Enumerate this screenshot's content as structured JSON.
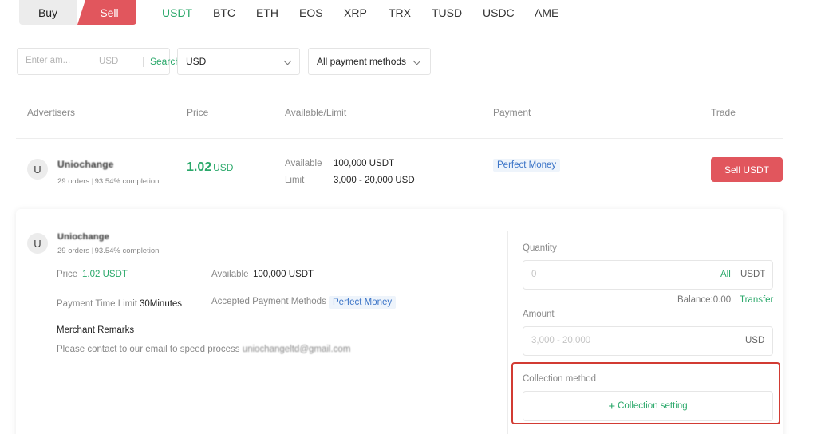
{
  "trade_tabs": {
    "buy": "Buy",
    "sell": "Sell"
  },
  "coins": [
    "USDT",
    "BTC",
    "ETH",
    "EOS",
    "XRP",
    "TRX",
    "TUSD",
    "USDC",
    "AME"
  ],
  "filters": {
    "amount_placeholder": "Enter am...",
    "amount_unit": "USD",
    "search_label": "Search",
    "currency": "USD",
    "payment_method": "All payment methods"
  },
  "table": {
    "headers": {
      "advertisers": "Advertisers",
      "price": "Price",
      "available_limit": "Available/Limit",
      "payment": "Payment",
      "trade": "Trade"
    }
  },
  "listing": {
    "avatar_letter": "U",
    "merchant": "Uniochange",
    "orders": "29 orders",
    "completion": "93.54% completion",
    "price": "1.02",
    "price_currency": "USD",
    "available_label": "Available",
    "available_value": "100,000 USDT",
    "limit_label": "Limit",
    "limit_value": "3,000 - 20,000 USD",
    "payment_method": "Perfect Money",
    "action_label": "Sell USDT"
  },
  "detail": {
    "avatar_letter": "U",
    "merchant": "Uniochange",
    "orders": "29 orders",
    "completion": "93.54% completion",
    "price_label": "Price",
    "price_value": "1.02 USDT",
    "available_label": "Available",
    "available_value": "100,000 USDT",
    "time_limit_label": "Payment Time Limit",
    "time_limit_value": "30Minutes",
    "accepted_label": "Accepted Payment Methods",
    "accepted_value": "Perfect Money",
    "remarks_title": "Merchant Remarks",
    "remarks_text": "Please contact to our email to speed process",
    "remarks_email": "uniochangeltd@gmail.com"
  },
  "order_form": {
    "quantity_label": "Quantity",
    "quantity_placeholder": "0",
    "all_label": "All",
    "quantity_unit": "USDT",
    "balance_text": "Balance:0.00",
    "transfer_label": "Transfer",
    "amount_label": "Amount",
    "amount_placeholder": "3,000 - 20,000",
    "amount_unit": "USD",
    "collection_method_label": "Collection method",
    "collection_button_plus": "+",
    "collection_button_label": "Collection setting"
  },
  "colors": {
    "accent_green": "#2aa86a",
    "sell_red": "#e1565d",
    "chip_blue": "#3b74c7",
    "highlight_red": "#d23b33"
  }
}
